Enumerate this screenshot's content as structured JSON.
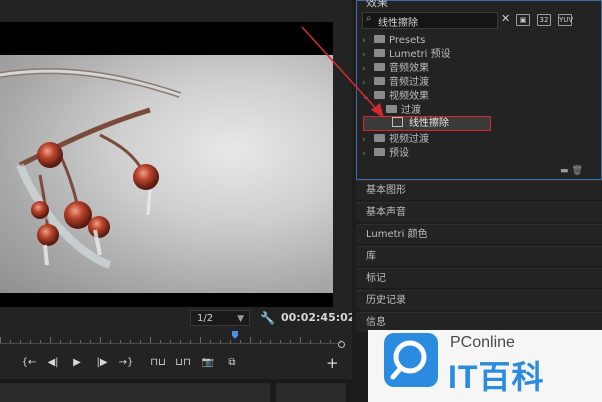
{
  "monitor": {
    "resolution": "1/2",
    "timecode": "00:02:45:02",
    "transport_buttons": [
      "{←",
      "◀|",
      "▶",
      "|▶",
      "→}",
      "⊓⊔",
      "⊔⊓",
      "📷",
      "⧉"
    ],
    "add_label": "+"
  },
  "effects": {
    "title": "效果",
    "search_value": "线性擦除",
    "tree": [
      {
        "label": "Presets",
        "level": 0,
        "expanded": false
      },
      {
        "label": "Lumetri 预设",
        "level": 0,
        "expanded": false
      },
      {
        "label": "音频效果",
        "level": 0,
        "expanded": false
      },
      {
        "label": "音频过渡",
        "level": 0,
        "expanded": false
      },
      {
        "label": "视频效果",
        "level": 0,
        "expanded": true
      },
      {
        "label": "过渡",
        "level": 1,
        "expanded": true
      },
      {
        "label": "线性擦除",
        "level": 2,
        "selected": true
      },
      {
        "label": "视频过渡",
        "level": 0,
        "expanded": false
      },
      {
        "label": "预设",
        "level": 0,
        "expanded": false
      }
    ]
  },
  "panels": [
    "基本图形",
    "基本声音",
    "Lumetri 颜色",
    "库",
    "标记",
    "历史记录",
    "信息"
  ],
  "watermark": {
    "brand": "PConline",
    "name": "IT百科"
  },
  "colors": {
    "accent_blue": "#3d6aa8",
    "highlight_red": "#d4292c",
    "playhead": "#4a8fe0",
    "logo_blue": "#2a8be0"
  }
}
